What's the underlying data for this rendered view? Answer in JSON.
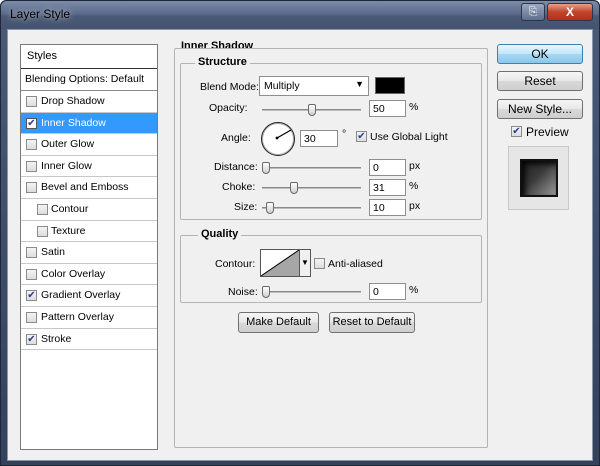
{
  "window": {
    "title": "Layer Style",
    "help_icon": "⎘",
    "close_label": "X"
  },
  "styles_panel": {
    "header": "Styles",
    "blending_options": "Blending Options: Default",
    "items": [
      {
        "label": "Drop Shadow",
        "checked": false,
        "selected": false,
        "sub": false
      },
      {
        "label": "Inner Shadow",
        "checked": true,
        "selected": true,
        "sub": false
      },
      {
        "label": "Outer Glow",
        "checked": false,
        "selected": false,
        "sub": false
      },
      {
        "label": "Inner Glow",
        "checked": false,
        "selected": false,
        "sub": false
      },
      {
        "label": "Bevel and Emboss",
        "checked": false,
        "selected": false,
        "sub": false
      },
      {
        "label": "Contour",
        "checked": false,
        "selected": false,
        "sub": true
      },
      {
        "label": "Texture",
        "checked": false,
        "selected": false,
        "sub": true
      },
      {
        "label": "Satin",
        "checked": false,
        "selected": false,
        "sub": false
      },
      {
        "label": "Color Overlay",
        "checked": false,
        "selected": false,
        "sub": false
      },
      {
        "label": "Gradient Overlay",
        "checked": true,
        "selected": false,
        "sub": false
      },
      {
        "label": "Pattern Overlay",
        "checked": false,
        "selected": false,
        "sub": false
      },
      {
        "label": "Stroke",
        "checked": true,
        "selected": false,
        "sub": false
      }
    ]
  },
  "inner_shadow": {
    "section_title": "Inner Shadow",
    "structure": {
      "title": "Structure",
      "blend_mode_label": "Blend Mode:",
      "blend_mode_value": "Multiply",
      "shadow_color": "#000000",
      "opacity_label": "Opacity:",
      "opacity_value": "50",
      "opacity_fraction": 0.5,
      "angle_label": "Angle:",
      "angle_value": "30",
      "angle_unit": "°",
      "use_global_light_label": "Use Global Light",
      "use_global_light_checked": true,
      "distance_label": "Distance:",
      "distance_value": "0",
      "distance_fraction": 0.0,
      "choke_label": "Choke:",
      "choke_value": "31",
      "choke_fraction": 0.31,
      "size_label": "Size:",
      "size_value": "10",
      "size_fraction": 0.04,
      "percent_unit": "%",
      "px_unit": "px"
    },
    "quality": {
      "title": "Quality",
      "contour_label": "Contour:",
      "anti_aliased_label": "Anti-aliased",
      "anti_aliased_checked": false,
      "noise_label": "Noise:",
      "noise_value": "0",
      "noise_fraction": 0.0,
      "percent_unit": "%"
    },
    "make_default_label": "Make Default",
    "reset_default_label": "Reset to Default"
  },
  "actions": {
    "ok_label": "OK",
    "reset_label": "Reset",
    "new_style_label": "New Style...",
    "preview_label": "Preview",
    "preview_checked": true
  }
}
